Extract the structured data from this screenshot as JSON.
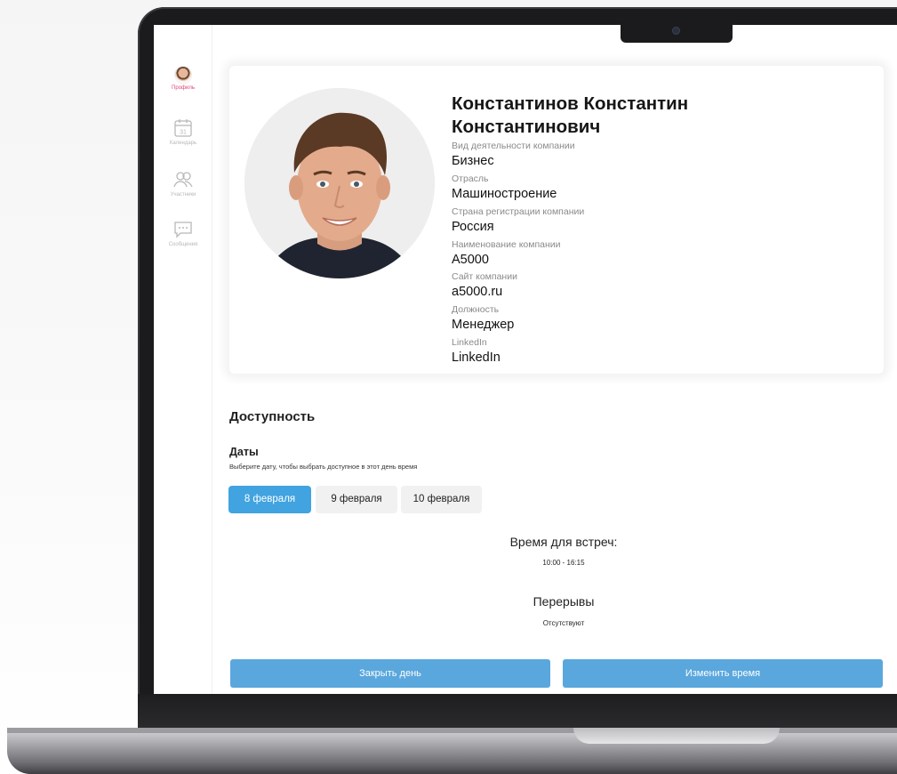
{
  "sidebar": {
    "items": [
      {
        "label": "Профиль",
        "icon": "profile-avatar-icon",
        "active": true
      },
      {
        "label": "Календарь",
        "icon": "calendar-icon",
        "day": "31"
      },
      {
        "label": "Участники",
        "icon": "people-icon"
      },
      {
        "label": "Сообщения",
        "icon": "message-icon"
      }
    ]
  },
  "profile": {
    "name_line1": "Константинов Константин",
    "name_line2": "Константинович",
    "fields": [
      {
        "label": "Вид деятельности компании",
        "value": "Бизнес"
      },
      {
        "label": "Отрасль",
        "value": "Машиностроение"
      },
      {
        "label": "Страна регистрации компании",
        "value": "Россия"
      },
      {
        "label": "Наименование компании",
        "value": "A5000"
      },
      {
        "label": "Сайт компании",
        "value": "a5000.ru"
      },
      {
        "label": "Должность",
        "value": "Менеджер"
      },
      {
        "label": "LinkedIn",
        "value": "LinkedIn"
      }
    ]
  },
  "availability": {
    "title": "Доступность",
    "dates_title": "Даты",
    "dates_hint": "Выберите дату, чтобы выбрать доступное в этот день время",
    "dates": [
      {
        "label": "8 февраля",
        "active": true
      },
      {
        "label": "9 февраля",
        "active": false
      },
      {
        "label": "10 февраля",
        "active": false
      }
    ],
    "meeting_title": "Время для встреч:",
    "meeting_time": "10:00 - 16:15",
    "breaks_title": "Перерывы",
    "breaks_value": "Отсутствуют"
  },
  "actions": {
    "close_day": "Закрыть день",
    "change_time": "Изменить время"
  },
  "colors": {
    "accent": "#41a3e0",
    "action": "#5aa7dd",
    "active_nav": "#e0447a"
  }
}
